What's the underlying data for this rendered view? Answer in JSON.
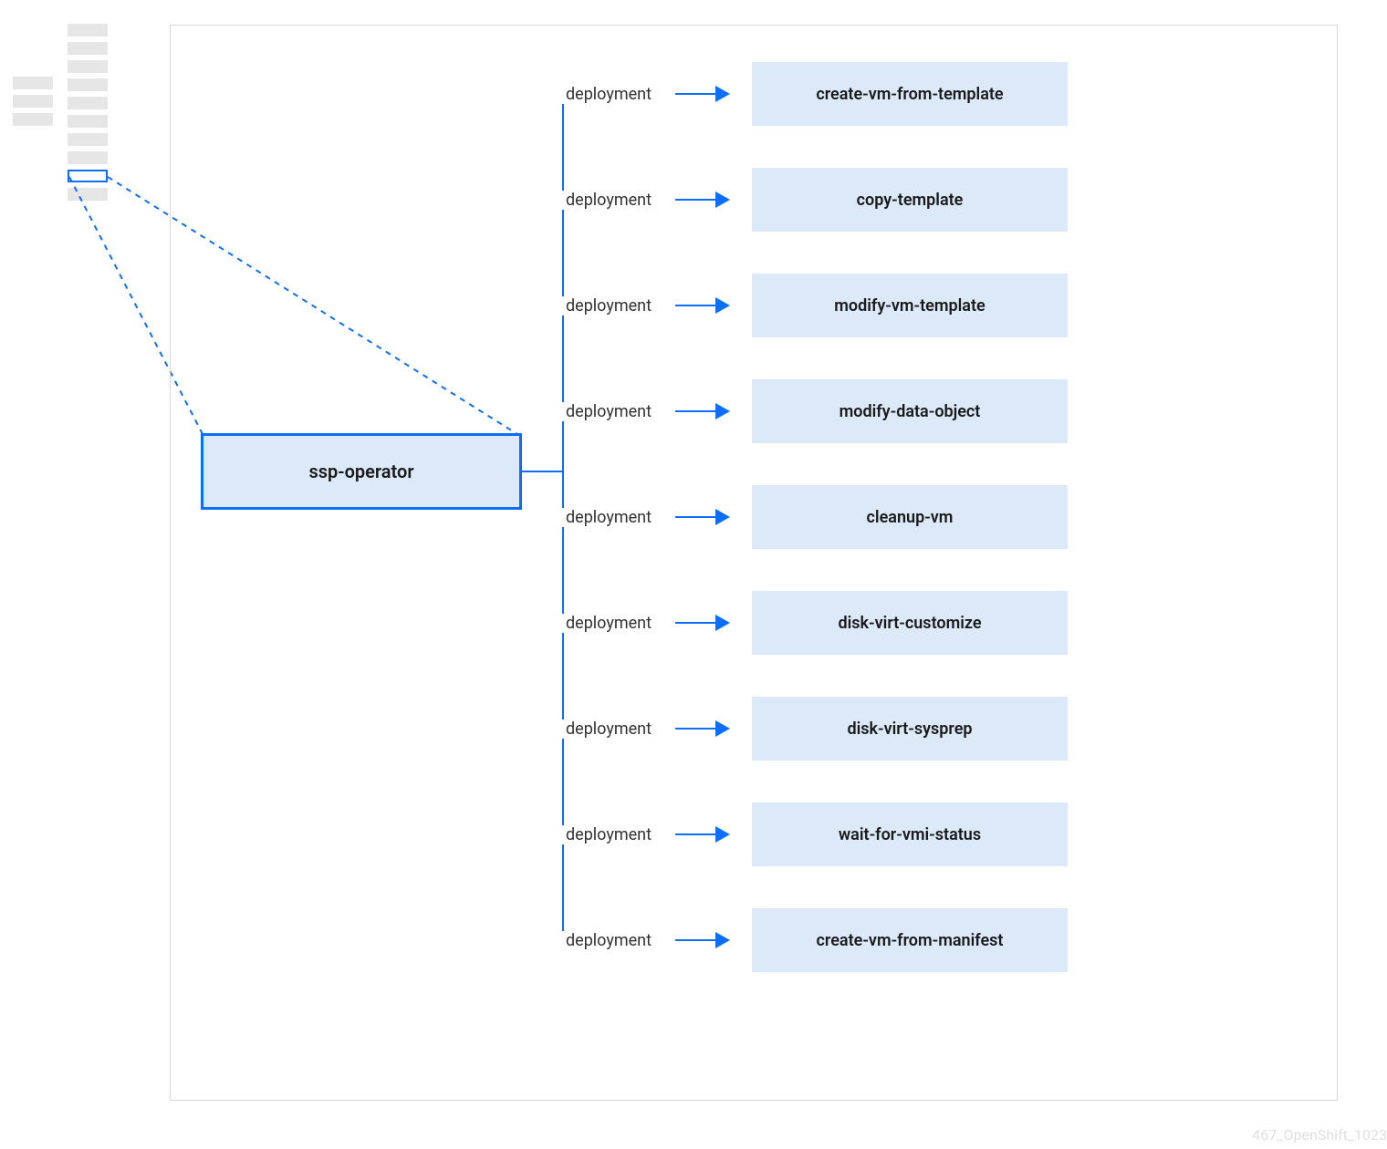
{
  "operator": {
    "label": "ssp-operator"
  },
  "edge_label": "deployment",
  "targets": [
    "create-vm-from-template",
    "copy-template",
    "modify-vm-template",
    "modify-data-object",
    "cleanup-vm",
    "disk-virt-customize",
    "disk-virt-sysprep",
    "wait-for-vmi-status",
    "create-vm-from-manifest"
  ],
  "footer": "467_OpenShift_1023",
  "colors": {
    "accent": "#0d6efd",
    "box_fill": "#dbe9f8",
    "grey": "#e6e6e6"
  }
}
